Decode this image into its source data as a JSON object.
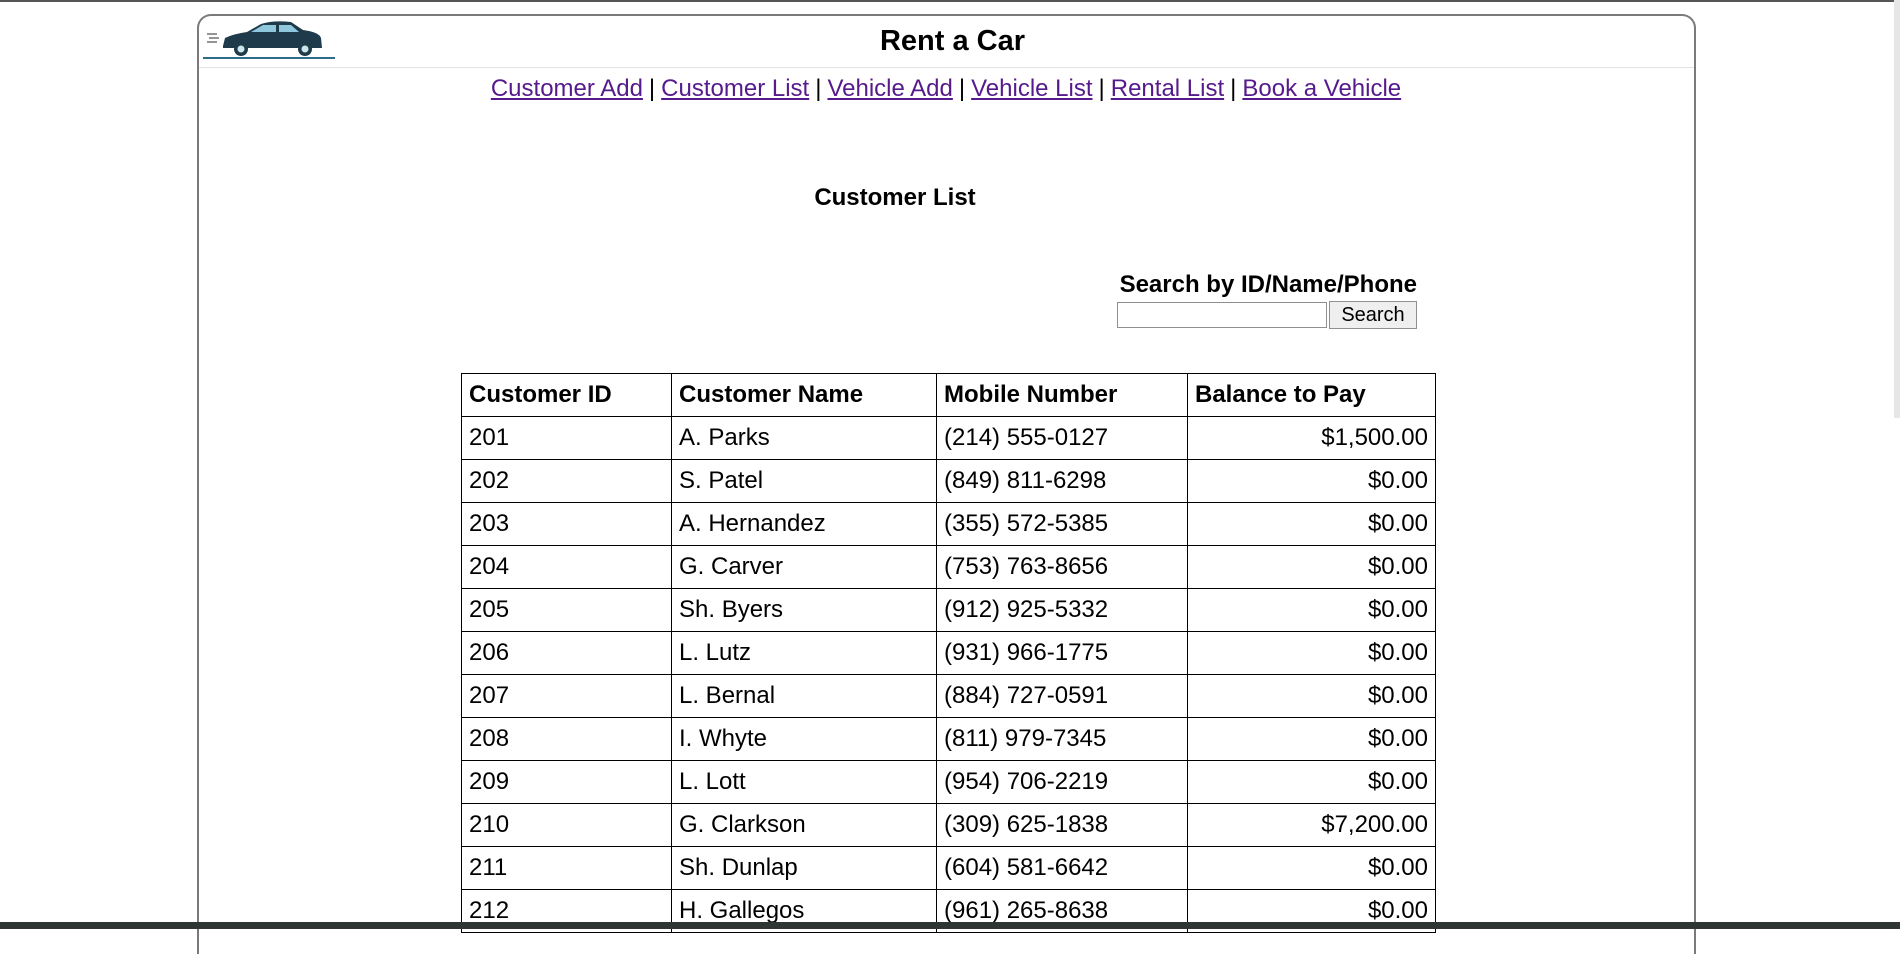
{
  "header": {
    "title": "Rent a Car",
    "logo_icon": "car-logo-icon"
  },
  "nav": {
    "items": [
      {
        "label": "Customer Add"
      },
      {
        "label": "Customer List"
      },
      {
        "label": "Vehicle Add"
      },
      {
        "label": "Vehicle List"
      },
      {
        "label": "Rental List"
      },
      {
        "label": "Book a Vehicle"
      }
    ],
    "separator": "|",
    "link_color": "#551a8b"
  },
  "page": {
    "heading": "Customer List"
  },
  "search": {
    "label": "Search by ID/Name/Phone",
    "value": "",
    "button_label": "Search"
  },
  "table": {
    "columns": [
      "Customer ID",
      "Customer Name",
      "Mobile Number",
      "Balance to Pay"
    ],
    "rows": [
      [
        "201",
        "A. Parks",
        "(214) 555-0127",
        "$1,500.00"
      ],
      [
        "202",
        "S. Patel",
        "(849) 811-6298",
        "$0.00"
      ],
      [
        "203",
        "A. Hernandez",
        "(355) 572-5385",
        "$0.00"
      ],
      [
        "204",
        "G. Carver",
        "(753) 763-8656",
        "$0.00"
      ],
      [
        "205",
        "Sh. Byers",
        "(912) 925-5332",
        "$0.00"
      ],
      [
        "206",
        "L. Lutz",
        "(931) 966-1775",
        "$0.00"
      ],
      [
        "207",
        "L. Bernal",
        "(884) 727-0591",
        "$0.00"
      ],
      [
        "208",
        "I. Whyte",
        "(811) 979-7345",
        "$0.00"
      ],
      [
        "209",
        "L. Lott",
        "(954) 706-2219",
        "$0.00"
      ],
      [
        "210",
        "G. Clarkson",
        "(309) 625-1838",
        "$7,200.00"
      ],
      [
        "211",
        "Sh. Dunlap",
        "(604) 581-6642",
        "$0.00"
      ],
      [
        "212",
        "H. Gallegos",
        "(961) 265-8638",
        "$0.00"
      ]
    ]
  }
}
